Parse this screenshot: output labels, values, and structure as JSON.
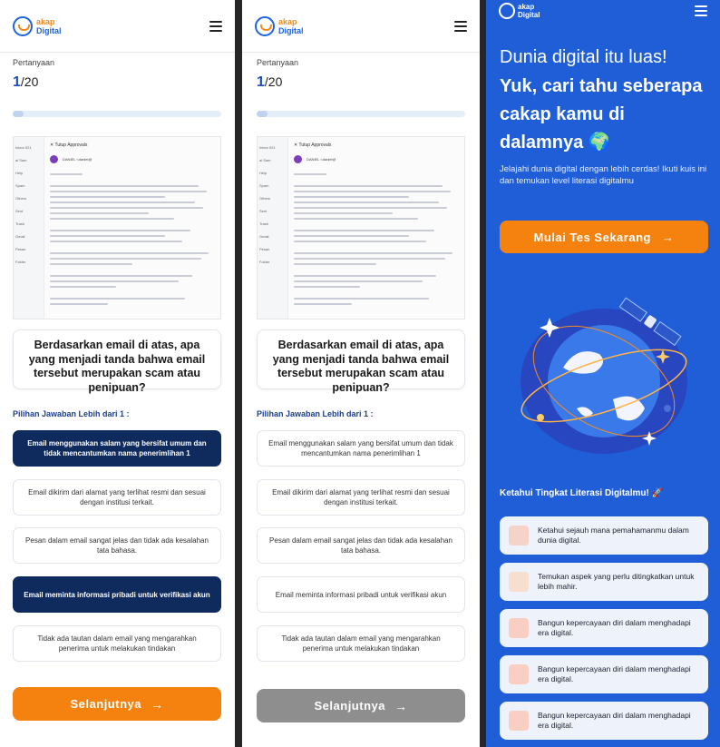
{
  "brand": {
    "line1": "akap",
    "line2": "Digital"
  },
  "quiz": {
    "question_label": "Pertanyaan",
    "current": "1",
    "total": "/20",
    "progress_fraction": 0.05,
    "email": {
      "sidebar": [
        "Inbox 921",
        "al Sam",
        "Help",
        "Spam",
        "Others",
        "Sent",
        "Trash",
        "Gmail",
        "Pesan",
        "Folder"
      ],
      "tab": "✕ Tutup   Approvals",
      "from": "DANIEL <daniel@"
    },
    "question": "Berdasarkan email di atas, apa yang menjadi tanda bahwa email tersebut merupakan scam atau penipuan?",
    "answers_label": "Pilihan Jawaban Lebih dari 1 :",
    "options": [
      "Email menggunakan salam yang bersifat umum dan tidak mencantumkan nama penerimlihan 1",
      "Email dikirim dari alamat yang terlihat resmi dan sesuai dengan institusi terkait.",
      "Pesan dalam email sangat jelas dan tidak ada kesalahan tata bahasa.",
      "Email meminta informasi pribadi untuk verifikasi akun",
      "Tidak ada tautan dalam email yang mengarahkan penerima untuk melakukan tindakan"
    ],
    "next_label": "Selanjutnya"
  },
  "landing": {
    "hero_line1": "Dunia digital itu luas!",
    "hero_line2": "Yuk, cari tahu seberapa cakap kamu di dalamnya 🌍",
    "subtitle": "Jelajahi dunia digital dengan lebih cerdas! Ikuti kuis ini dan temukan level literasi digitalmu",
    "cta_label": "Mulai Tes Sekarang",
    "section_title": "Ketahui Tingkat Literasi Digitalmu! 🚀",
    "features": [
      {
        "text": "Ketahui sejauh mana pemahamanmu dalam dunia digital.",
        "icon": "map-icon"
      },
      {
        "text": "Temukan aspek yang perlu ditingkatkan untuk lebih mahir.",
        "icon": "search-doc-icon"
      },
      {
        "text": "Bangun kepercayaan diri dalam menghadapi era digital.",
        "icon": "certificate-icon"
      },
      {
        "text": "Bangun kepercayaan diri dalam menghadapi era digital.",
        "icon": "certificate-icon"
      },
      {
        "text": "Bangun kepercayaan diri dalam menghadapi era digital.",
        "icon": "certificate-icon"
      }
    ]
  },
  "colors": {
    "brand_blue": "#1c64e0",
    "brand_orange": "#f5820f",
    "selected_option": "#0f2a5c",
    "disabled_button": "#8e8e8e",
    "landing_bg": "#1f5ed6"
  }
}
